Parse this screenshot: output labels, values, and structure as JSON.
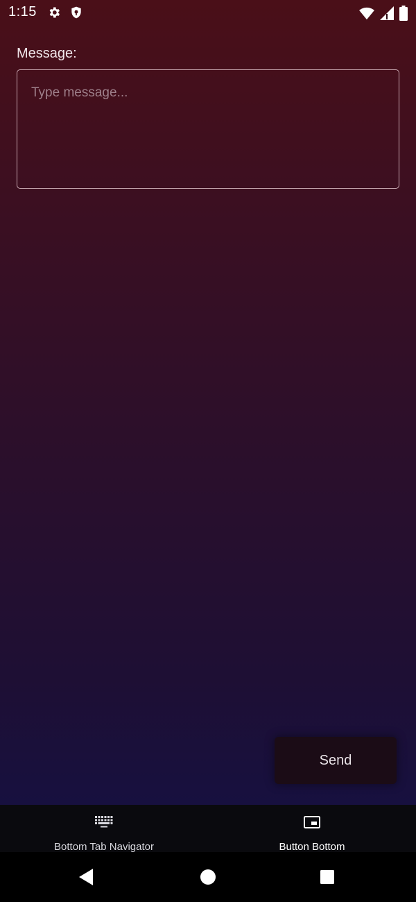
{
  "status_bar": {
    "time": "1:15",
    "icons": [
      "settings-gear-icon",
      "shield-icon",
      "wifi-icon",
      "cell-signal-icon",
      "battery-icon"
    ]
  },
  "form": {
    "label": "Message:",
    "input": {
      "value": "",
      "placeholder": "Type message..."
    },
    "send_label": "Send"
  },
  "tabs": [
    {
      "label": "Bottom Tab Navigator",
      "icon": "keyboard-icon",
      "active": false
    },
    {
      "label": "Button Bottom",
      "icon": "picture-in-picture-icon",
      "active": true
    }
  ],
  "nav_bar": {
    "buttons": [
      "back-icon",
      "home-icon",
      "recents-icon"
    ]
  },
  "colors": {
    "background_top": "#4a0f18",
    "background_bottom": "#120f3f",
    "input_border": "#c9a9b2",
    "tab_bar": "#0a0a0e",
    "send_button": "#1b0c16"
  }
}
